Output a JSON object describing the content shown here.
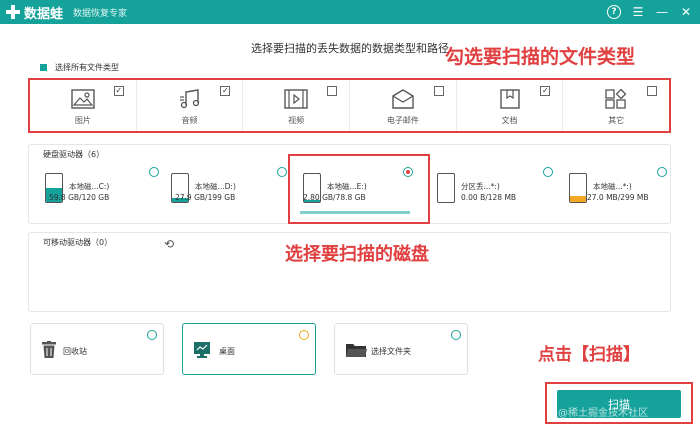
{
  "titlebar": {
    "app_name": "数据蛙",
    "subtitle": "数据恢复专家",
    "help": "?",
    "menu": "☰",
    "minimize": "—",
    "close": "✕"
  },
  "heading": "选择要扫描的丢失数据的数据类型和路径",
  "select_all_label": "选择所有文件类型",
  "file_types": [
    {
      "label": "图片",
      "checked": true,
      "icon": "image-icon"
    },
    {
      "label": "音频",
      "checked": true,
      "icon": "music-icon"
    },
    {
      "label": "视频",
      "checked": false,
      "icon": "video-icon"
    },
    {
      "label": "电子邮件",
      "checked": false,
      "icon": "email-icon"
    },
    {
      "label": "文档",
      "checked": true,
      "icon": "document-icon"
    },
    {
      "label": "其它",
      "checked": false,
      "icon": "other-icon"
    }
  ],
  "hdd_section": {
    "title": "硬盘驱动器（6）",
    "drives": [
      {
        "name": "本地磁...C:)",
        "size": "59.8 GB/120 GB",
        "selected": false,
        "fill_color": "#14a29a",
        "fill_fraction": 0.5
      },
      {
        "name": "本地磁...D:)",
        "size": "27.9 GB/199 GB",
        "selected": false,
        "fill_color": "#14a29a",
        "fill_fraction": 0.14
      },
      {
        "name": "本地磁...E:)",
        "size": "2.80 GB/78.8 GB",
        "selected": true,
        "fill_color": "#14a29a",
        "fill_fraction": 0.04
      },
      {
        "name": "分区丢...*:)",
        "size": "0.00  B/128 MB",
        "selected": false,
        "fill_color": "#f5a623",
        "fill_fraction": 0.0
      },
      {
        "name": "本地磁...*:)",
        "size": "27.0 MB/299 MB",
        "selected": false,
        "fill_color": "#f5a623",
        "fill_fraction": 0.2
      }
    ]
  },
  "removable_section": {
    "title": "可移动驱动器（0）",
    "refresh_icon": "⟲"
  },
  "locations": [
    {
      "label": "回收站",
      "icon": "recycle-bin-icon",
      "selected": false
    },
    {
      "label": "桌面",
      "icon": "desktop-icon",
      "selected": true
    },
    {
      "label": "选择文件夹",
      "icon": "folder-icon",
      "selected": false
    }
  ],
  "annotations": {
    "types": "勾选要扫描的文件类型",
    "disk": "选择要扫描的磁盘",
    "scan": "点击【扫描】"
  },
  "scan_button": "扫描",
  "watermark": "@稀土掘金技术社区",
  "colors": {
    "accent": "#14a29a",
    "annotation": "#e04040",
    "orange": "#f5a623"
  }
}
